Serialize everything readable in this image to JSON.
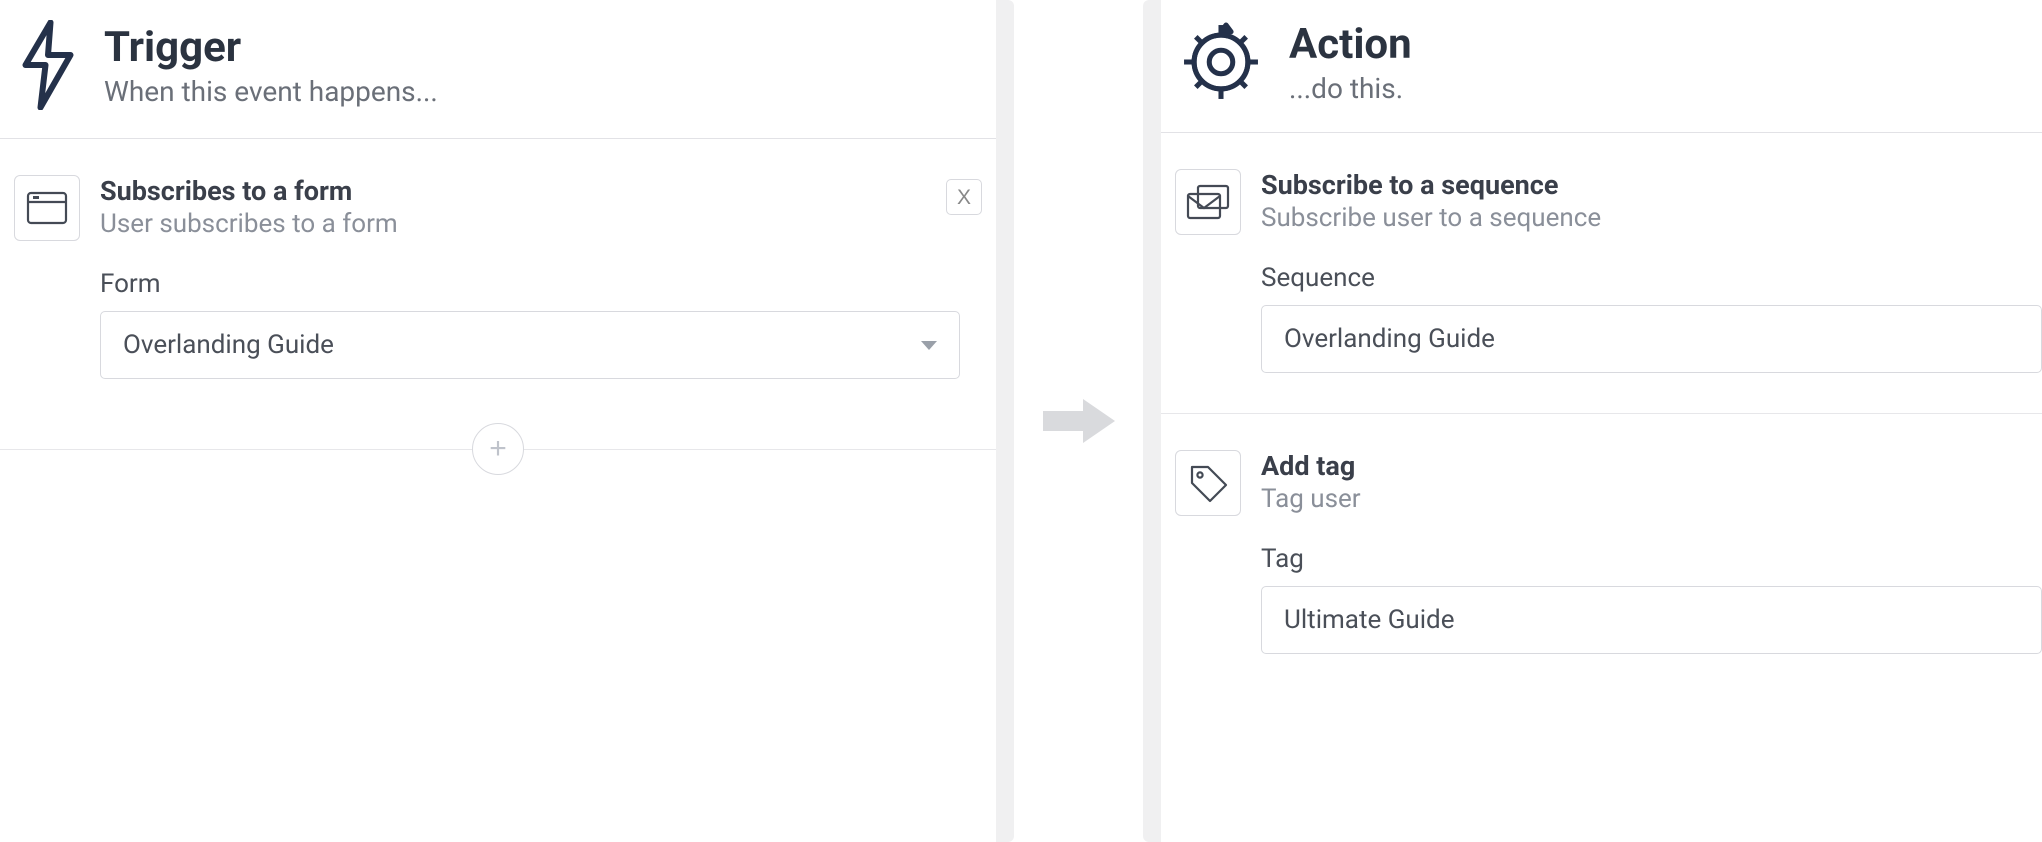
{
  "trigger": {
    "title": "Trigger",
    "subtitle": "When this event happens...",
    "card": {
      "title": "Subscribes to a form",
      "subtitle": "User subscribes to a form",
      "close": "X",
      "field_label": "Form",
      "field_value": "Overlanding Guide"
    },
    "add_label": "+"
  },
  "action": {
    "title": "Action",
    "subtitle": "...do this.",
    "cards": [
      {
        "title": "Subscribe to a sequence",
        "subtitle": "Subscribe user to a sequence",
        "field_label": "Sequence",
        "field_value": "Overlanding Guide"
      },
      {
        "title": "Add tag",
        "subtitle": "Tag user",
        "field_label": "Tag",
        "field_value": "Ultimate Guide"
      }
    ]
  }
}
